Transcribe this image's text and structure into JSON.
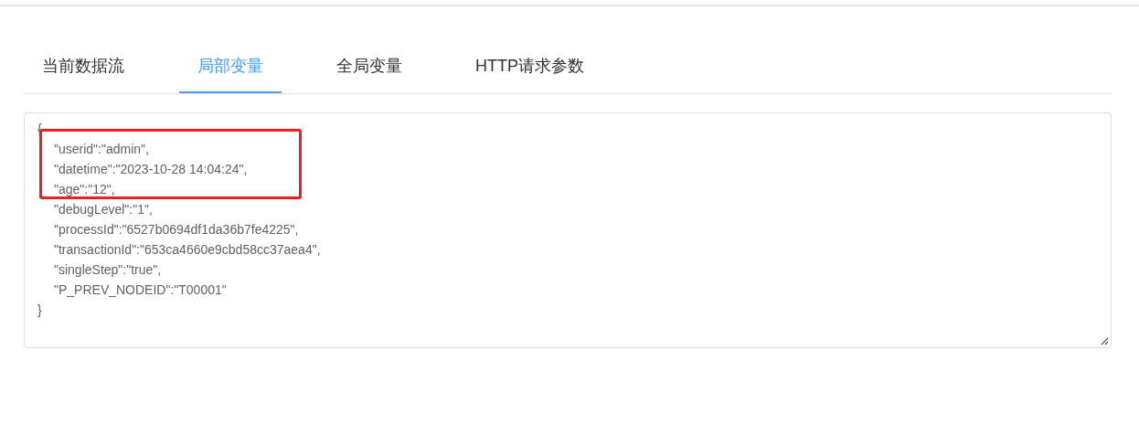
{
  "tabs": [
    {
      "label": "当前数据流",
      "selected": false
    },
    {
      "label": "局部变量",
      "selected": true
    },
    {
      "label": "全局变量",
      "selected": false
    },
    {
      "label": "HTTP请求参数",
      "selected": false
    }
  ],
  "editor": {
    "open_brace": "{",
    "entries": [
      "\"userid\":\"admin\",",
      "\"datetime\":\"2023-10-28 14:04:24\",",
      "\"age\":\"12\",",
      "\"debugLevel\":\"1\",",
      "\"processId\":\"6527b0694df1da36b7fe4225\",",
      "\"transactionId\":\"653ca4660e9cbd58cc37aea4\",",
      "\"singleStep\":\"true\",",
      "\"P_PREV_NODEID\":\"T00001\""
    ],
    "close_brace": "}"
  }
}
